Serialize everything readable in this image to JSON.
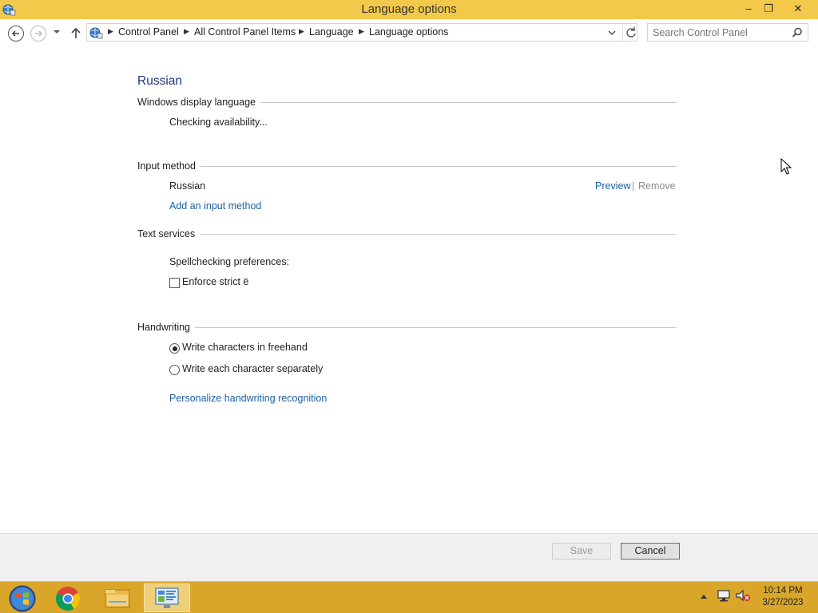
{
  "window": {
    "title": "Language options",
    "minimize_label": "–",
    "maximize_label": "❐",
    "close_label": "✕"
  },
  "address_bar": {
    "breadcrumbs": [
      "Control Panel",
      "All Control Panel Items",
      "Language",
      "Language options"
    ],
    "search_placeholder": "Search Control Panel"
  },
  "content": {
    "language_name": "Russian",
    "display_language": {
      "heading": "Windows display language",
      "status": "Checking availability..."
    },
    "input_method": {
      "heading": "Input method",
      "method_name": "Russian",
      "preview_link": "Preview",
      "separator": "|",
      "remove_link": "Remove",
      "add_link": "Add an input method"
    },
    "text_services": {
      "heading": "Text services",
      "spellcheck_label": "Spellchecking preferences:",
      "strict_yo_label": "Enforce strict ё",
      "strict_yo_checked": false
    },
    "handwriting": {
      "heading": "Handwriting",
      "option_freehand": "Write characters in freehand",
      "option_separate": "Write each character separately",
      "selected": "freehand",
      "personalize_link": "Personalize handwriting recognition"
    }
  },
  "buttons": {
    "save": "Save",
    "cancel": "Cancel"
  },
  "taskbar": {
    "time": "10:14 PM",
    "date": "3/27/2023"
  },
  "colors": {
    "titlebar": "#f2c94a",
    "taskbar": "#d9a629",
    "link": "#1a5fa8",
    "heading_blue": "#1e3287"
  }
}
